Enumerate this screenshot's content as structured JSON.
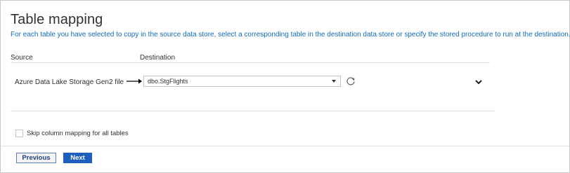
{
  "header": {
    "title": "Table mapping",
    "description": "For each table you have selected to copy in the source data store, select a corresponding table in the destination data store or specify the stored procedure to run at the destination."
  },
  "columns": {
    "source": "Source",
    "destination": "Destination"
  },
  "mapping_row": {
    "source_name": "Azure Data Lake Storage Gen2 file",
    "destination_value": "dbo.StgFlights"
  },
  "options": {
    "skip_mapping_label": "Skip column mapping for all tables",
    "skip_mapping_checked": false
  },
  "footer": {
    "previous_label": "Previous",
    "next_label": "Next"
  },
  "colors": {
    "accent": "#1f5fbf",
    "description_text": "#0f6cbd",
    "divider": "#e1dfdd"
  },
  "icons": {
    "arrow": "arrow-right-icon",
    "refresh": "refresh-icon",
    "expand": "chevron-down-icon",
    "dropdown": "caret-down-icon"
  }
}
